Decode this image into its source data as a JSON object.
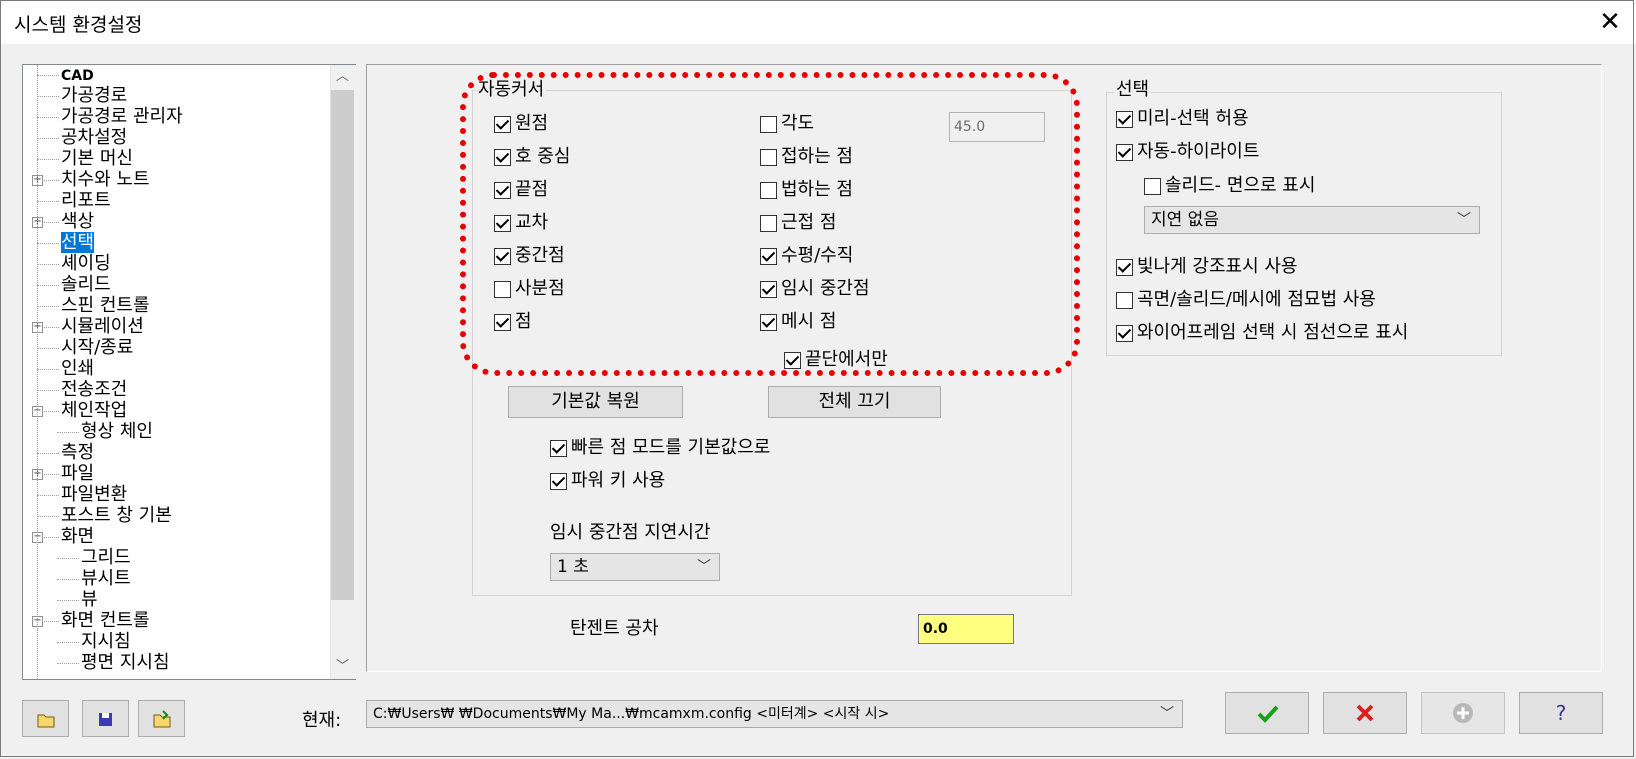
{
  "window": {
    "title": "시스템 환경설정"
  },
  "tree": {
    "items": [
      {
        "label": "CAD",
        "level": 0,
        "bold": true
      },
      {
        "label": "가공경로",
        "level": 0
      },
      {
        "label": "가공경로 관리자",
        "level": 0
      },
      {
        "label": "공차설정",
        "level": 0
      },
      {
        "label": "기본 머신",
        "level": 0
      },
      {
        "label": "치수와 노트",
        "level": 0,
        "expander": "+"
      },
      {
        "label": "리포트",
        "level": 0
      },
      {
        "label": "색상",
        "level": 0,
        "expander": "+"
      },
      {
        "label": "선택",
        "level": 0,
        "selected": true
      },
      {
        "label": "셰이딩",
        "level": 0
      },
      {
        "label": "솔리드",
        "level": 0
      },
      {
        "label": "스핀 컨트롤",
        "level": 0
      },
      {
        "label": "시뮬레이션",
        "level": 0,
        "expander": "+"
      },
      {
        "label": "시작/종료",
        "level": 0
      },
      {
        "label": "인쇄",
        "level": 0
      },
      {
        "label": "전송조건",
        "level": 0
      },
      {
        "label": "체인작업",
        "level": 0,
        "expander": "−"
      },
      {
        "label": "형상 체인",
        "level": 1
      },
      {
        "label": "측정",
        "level": 0
      },
      {
        "label": "파일",
        "level": 0,
        "expander": "+"
      },
      {
        "label": "파일변환",
        "level": 0
      },
      {
        "label": "포스트 창 기본",
        "level": 0
      },
      {
        "label": "화면",
        "level": 0,
        "expander": "−"
      },
      {
        "label": "그리드",
        "level": 1
      },
      {
        "label": "뷰시트",
        "level": 1
      },
      {
        "label": "뷰",
        "level": 1
      },
      {
        "label": "화면 컨트롤",
        "level": 0,
        "expander": "−"
      },
      {
        "label": "지시침",
        "level": 1
      },
      {
        "label": "평면 지시침",
        "level": 1
      }
    ]
  },
  "autocursor": {
    "title": "자동커서",
    "left": [
      {
        "label": "원점",
        "checked": true
      },
      {
        "label": "호 중심",
        "checked": true
      },
      {
        "label": "끝점",
        "checked": true
      },
      {
        "label": "교차",
        "checked": true
      },
      {
        "label": "중간점",
        "checked": true
      },
      {
        "label": "사분점",
        "checked": false
      },
      {
        "label": "점",
        "checked": true
      }
    ],
    "right": [
      {
        "label": "각도",
        "checked": false
      },
      {
        "label": "접하는 점",
        "checked": false
      },
      {
        "label": "법하는 점",
        "checked": false
      },
      {
        "label": "근접 점",
        "checked": false
      },
      {
        "label": "수평/수직",
        "checked": true
      },
      {
        "label": "임시 중간점",
        "checked": true
      },
      {
        "label": "메시 점",
        "checked": true
      }
    ],
    "angle_value": "45.0",
    "ends_only": {
      "label": "끝단에서만",
      "checked": true
    },
    "restore_button": "기본값 복원",
    "all_off_button": "전체 끄기",
    "fast_point": {
      "label": "빠른 점 모드를 기본값으로",
      "checked": true
    },
    "power_key": {
      "label": "파워 키 사용",
      "checked": true
    },
    "delay_label": "임시 중간점 지연시간",
    "delay_value": "1 초"
  },
  "tangent": {
    "label": "탄젠트 공차",
    "value": "0.0"
  },
  "selection": {
    "title": "선택",
    "preselect": {
      "label": "미리-선택 허용",
      "checked": true
    },
    "autohighlight": {
      "label": "자동-하이라이트",
      "checked": true
    },
    "solid_face": {
      "label": "솔리드- 면으로 표시",
      "checked": false
    },
    "delay_value": "지연 없음",
    "glow": {
      "label": "빛나게 강조표시 사용",
      "checked": true
    },
    "stipple": {
      "label": "곡면/솔리드/메시에 점묘법 사용",
      "checked": false
    },
    "wireframe": {
      "label": "와이어프레임 선택 시 점선으로 표시",
      "checked": true
    }
  },
  "footer": {
    "current_label": "현재:",
    "current_path": "C:₩Users₩                   ₩Documents₩My Ma...₩mcamxm.config <미터계> <시작 시>",
    "ok_icon": "checkmark-icon",
    "cancel_icon": "red-x-icon",
    "add_icon": "plus-icon",
    "help_icon": "question-icon",
    "colors": {
      "ok": "#18a018",
      "cancel": "#e02020",
      "highlight": "#0078d7",
      "annotation": "#e60000"
    }
  }
}
